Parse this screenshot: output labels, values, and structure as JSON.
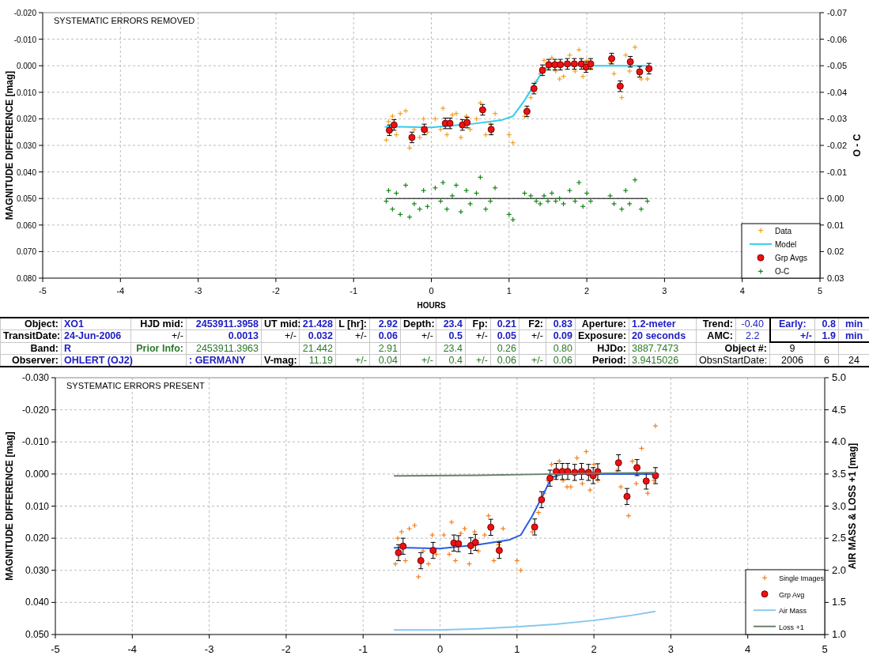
{
  "charts": [
    {
      "chart_data": {
        "type": "scatter",
        "title": "SYSTEMATIC ERRORS REMOVED",
        "xlabel": "HOURS",
        "ylabel": "MAGNITUDE DIFFERENCE [mag]",
        "y2label": "O - C",
        "grid": true,
        "legend": "lower right",
        "xlim": [
          -5,
          5
        ],
        "ylim": [
          0.08,
          -0.02
        ],
        "y2lim": [
          0.03,
          -0.07
        ],
        "ref_lines": [
          {
            "axis": "y2",
            "value": 0,
            "color": "#000000"
          }
        ],
        "xticks": [
          -5,
          -4,
          -3,
          -2,
          -1,
          0,
          1,
          2,
          3,
          4,
          5
        ],
        "yticks": [
          {
            "value": -0.02,
            "label": "-0.020"
          },
          {
            "value": -0.01,
            "label": "-0.010"
          },
          {
            "value": 0,
            "label": "0.000"
          },
          {
            "value": 0.01,
            "label": "0.010"
          },
          {
            "value": 0.02,
            "label": "0.020"
          },
          {
            "value": 0.03,
            "label": "0.030"
          },
          {
            "value": 0.04,
            "label": "0.040"
          },
          {
            "value": 0.05,
            "label": "0.050"
          },
          {
            "value": 0.06,
            "label": "0.060"
          },
          {
            "value": 0.07,
            "label": "0.070"
          },
          {
            "value": 0.08,
            "label": "0.080"
          }
        ],
        "y2ticks": [
          {
            "value": -0.07,
            "label": "-0.07"
          },
          {
            "value": -0.06,
            "label": "-0.06"
          },
          {
            "value": -0.05,
            "label": "-0.05"
          },
          {
            "value": -0.04,
            "label": "-0.04"
          },
          {
            "value": -0.03,
            "label": "-0.03"
          },
          {
            "value": -0.02,
            "label": "-0.02"
          },
          {
            "value": -0.01,
            "label": "-0.01"
          },
          {
            "value": 0,
            "label": "0.00"
          },
          {
            "value": 0.01,
            "label": "0.01"
          },
          {
            "value": 0.02,
            "label": "0.02"
          },
          {
            "value": 0.03,
            "label": "0.03"
          }
        ],
        "series": [
          {
            "name": "Data",
            "type": "scatter",
            "color": "#f0a020",
            "x": [
              -0.58,
              -0.55,
              -0.5,
              -0.45,
              -0.4,
              -0.33,
              -0.28,
              -0.22,
              -0.15,
              -0.1,
              -0.05,
              0.05,
              0.12,
              0.15,
              0.2,
              0.27,
              0.32,
              0.38,
              0.45,
              0.5,
              0.58,
              0.63,
              0.7,
              0.76,
              0.82,
              1.0,
              1.05,
              1.2,
              1.28,
              1.35,
              1.4,
              1.45,
              1.5,
              1.55,
              1.6,
              1.65,
              1.7,
              1.78,
              1.85,
              1.9,
              1.95,
              2.0,
              2.05,
              2.3,
              2.35,
              2.45,
              2.5,
              2.55,
              2.62,
              2.7,
              2.78
            ],
            "values": [
              0.028,
              0.021,
              0.019,
              0.026,
              0.018,
              0.017,
              0.031,
              0.024,
              0.027,
              0.02,
              0.025,
              0.02,
              0.024,
              0.016,
              0.026,
              0.0185,
              0.018,
              0.027,
              0.019,
              0.024,
              0.02,
              0.014,
              0.026,
              0.022,
              0.018,
              0.026,
              0.029,
              0.019,
              0.012,
              0.006,
              0.003,
              -0.002,
              0.001,
              -0.003,
              0.002,
              0.005,
              0.004,
              -0.004,
              0.002,
              -0.006,
              0.004,
              -0.002,
              0.001,
              -0.001,
              0.003,
              0.012,
              -0.004,
              0.002,
              -0.007,
              0.005,
              0.005
            ]
          },
          {
            "name": "Model",
            "type": "line",
            "color": "#33ccee",
            "x": [
              -0.6,
              -0.4,
              0,
              0.5,
              0.9,
              1.05,
              1.2,
              1.35,
              1.45,
              1.6,
              2.8
            ],
            "values": [
              0.023,
              0.023,
              0.0232,
              0.022,
              0.0205,
              0.019,
              0.013,
              0.006,
              0.001,
              0,
              0
            ]
          },
          {
            "name": "Grp Avgs",
            "type": "scatter",
            "color": "#ee1111",
            "errors": [
              0.002,
              0.002,
              0.002,
              0.002,
              0.002,
              0.002,
              0.002,
              0.002,
              0.002,
              0.002,
              0.002,
              0.002,
              0.002,
              0.002,
              0.002,
              0.002,
              0.002,
              0.002,
              0.002,
              0.002,
              0.002,
              0.002,
              0.002,
              0.002,
              0.002,
              0.002
            ],
            "x": [
              -0.54,
              -0.48,
              -0.25,
              -0.09,
              0.18,
              0.24,
              0.4,
              0.46,
              0.66,
              0.77,
              1.23,
              1.32,
              1.43,
              1.51,
              1.59,
              1.66,
              1.75,
              1.84,
              1.93,
              1.99,
              2.05,
              2.32,
              2.43,
              2.56,
              2.68,
              2.8
            ],
            "values": [
              0.0243,
              0.0223,
              0.027,
              0.024,
              0.0217,
              0.0217,
              0.0223,
              0.0214,
              0.0166,
              0.024,
              0.0172,
              0.0086,
              0.0017,
              -0.0004,
              -0.0004,
              -0.0004,
              -0.0007,
              -0.0007,
              -0.0007,
              0.0005,
              -0.0007,
              -0.0027,
              0.0077,
              -0.0015,
              0.0023,
              0.0011
            ]
          },
          {
            "name": "O-C",
            "type": "scatter",
            "axis": "y2",
            "color": "#118811",
            "x": [
              -0.58,
              -0.55,
              -0.5,
              -0.45,
              -0.4,
              -0.33,
              -0.28,
              -0.22,
              -0.15,
              -0.1,
              -0.05,
              0.05,
              0.12,
              0.15,
              0.2,
              0.27,
              0.32,
              0.38,
              0.45,
              0.5,
              0.58,
              0.63,
              0.7,
              0.76,
              0.82,
              1.0,
              1.05,
              1.2,
              1.28,
              1.35,
              1.4,
              1.45,
              1.5,
              1.55,
              1.6,
              1.65,
              1.7,
              1.78,
              1.85,
              1.9,
              1.95,
              2.0,
              2.05,
              2.3,
              2.35,
              2.45,
              2.5,
              2.55,
              2.62,
              2.7,
              2.78
            ],
            "values": [
              0.001,
              -0.003,
              0.004,
              -0.002,
              0.006,
              -0.005,
              0.007,
              0.002,
              0.004,
              -0.003,
              0.003,
              -0.004,
              0.001,
              -0.006,
              0.004,
              -0.001,
              -0.005,
              0.005,
              -0.003,
              0.002,
              -0.002,
              -0.008,
              0.004,
              0.001,
              -0.004,
              0.006,
              0.008,
              -0.002,
              -0.001,
              0.001,
              0.002,
              -0.001,
              0.001,
              -0.002,
              0.001,
              0,
              0.002,
              -0.003,
              0.001,
              -0.006,
              0.003,
              -0.002,
              0.001,
              -0.001,
              0.002,
              0.004,
              -0.003,
              0.002,
              -0.007,
              0.004,
              0.001
            ]
          }
        ]
      }
    },
    {
      "table": {
        "rows": [
          [
            {
              "text": "Object:",
              "kind": "label"
            },
            {
              "text": "XO1",
              "kind": "text"
            },
            {
              "text": "HJD mid:",
              "kind": "label"
            },
            {
              "text": "2453911.3958",
              "kind": "value"
            },
            {
              "text": "UT mid:",
              "kind": "label"
            },
            {
              "text": "21.428",
              "kind": "value"
            },
            {
              "text": "L [hr]:",
              "kind": "label"
            },
            {
              "text": "2.92",
              "kind": "value"
            },
            {
              "text": "Depth:",
              "kind": "label"
            },
            {
              "text": "23.4",
              "kind": "value"
            },
            {
              "text": "Fp:",
              "kind": "label"
            },
            {
              "text": "0.21",
              "kind": "value"
            },
            {
              "text": "F2:",
              "kind": "label"
            },
            {
              "text": "0.83",
              "kind": "value"
            },
            {
              "text": "Aperture:",
              "kind": "label"
            },
            {
              "text": "1.2-meter",
              "kind": "text"
            },
            {
              "text": "Trend:",
              "kind": "label"
            },
            {
              "text": "-0.40",
              "kind": "plain_blue"
            },
            {
              "text": "Early:",
              "kind": "value_center"
            },
            {
              "text": "0.8",
              "kind": "value"
            },
            {
              "text": "min",
              "kind": "value_center"
            }
          ],
          [
            {
              "text": "TransitDate:",
              "kind": "label"
            },
            {
              "text": "24-Jun-2006",
              "kind": "text"
            },
            {
              "text": "+/-",
              "kind": "plain"
            },
            {
              "text": "0.0013",
              "kind": "value"
            },
            {
              "text": "+/-",
              "kind": "plain"
            },
            {
              "text": "0.032",
              "kind": "value"
            },
            {
              "text": "+/-",
              "kind": "plain"
            },
            {
              "text": "0.06",
              "kind": "value"
            },
            {
              "text": "+/-",
              "kind": "plain"
            },
            {
              "text": "0.5",
              "kind": "value"
            },
            {
              "text": "+/-",
              "kind": "plain"
            },
            {
              "text": "0.05",
              "kind": "value"
            },
            {
              "text": "+/-",
              "kind": "plain"
            },
            {
              "text": "0.09",
              "kind": "value"
            },
            {
              "text": "Exposure:",
              "kind": "label"
            },
            {
              "text": "20 seconds",
              "kind": "text"
            },
            {
              "text": "AMC:",
              "kind": "label"
            },
            {
              "text": "2.2",
              "kind": "plain_blue"
            },
            {
              "text": "+/-",
              "kind": "value"
            },
            {
              "text": "1.9",
              "kind": "value"
            },
            {
              "text": "min",
              "kind": "value_center"
            }
          ],
          [
            {
              "text": "Band:",
              "kind": "label"
            },
            {
              "text": "R",
              "kind": "text"
            },
            {
              "text": "Prior Info:",
              "kind": "prior_label"
            },
            {
              "text": "2453911.3963",
              "kind": "prior"
            },
            {
              "kind": "empty"
            },
            {
              "text": "21.442",
              "kind": "prior"
            },
            {
              "kind": "empty"
            },
            {
              "text": "2.91",
              "kind": "prior"
            },
            {
              "kind": "empty"
            },
            {
              "text": "23.4",
              "kind": "prior"
            },
            {
              "kind": "empty"
            },
            {
              "text": "0.26",
              "kind": "prior"
            },
            {
              "kind": "empty"
            },
            {
              "text": "0.80",
              "kind": "prior"
            },
            {
              "text": "HJDo:",
              "kind": "label"
            },
            {
              "text": "3887.7473",
              "kind": "prior_left"
            },
            {
              "text": "Object #:",
              "kind": "label",
              "colspan": 2
            },
            {
              "text": "9",
              "kind": "plain_center"
            },
            {
              "kind": "empty"
            },
            {
              "kind": "empty"
            }
          ],
          [
            {
              "text": "Observer:",
              "kind": "label"
            },
            {
              "text": "OHLERT (OJ2)",
              "kind": "text"
            },
            {
              "kind": "empty"
            },
            {
              "text": ": GERMANY",
              "kind": "text"
            },
            {
              "text": "V-mag:",
              "kind": "label"
            },
            {
              "text": "11.19",
              "kind": "prior"
            },
            {
              "text": "+/-",
              "kind": "prior"
            },
            {
              "text": "0.04",
              "kind": "prior"
            },
            {
              "text": "+/-",
              "kind": "prior"
            },
            {
              "text": "0.4",
              "kind": "prior"
            },
            {
              "text": "+/-",
              "kind": "prior"
            },
            {
              "text": "0.06",
              "kind": "prior"
            },
            {
              "text": "+/-",
              "kind": "prior"
            },
            {
              "text": "0.06",
              "kind": "prior"
            },
            {
              "text": "Period:",
              "kind": "label"
            },
            {
              "text": "3.9415026",
              "kind": "prior_left"
            },
            {
              "text": "ObsnStartDate:",
              "kind": "plain",
              "colspan": 2
            },
            {
              "text": "2006",
              "kind": "plain_center"
            },
            {
              "text": "6",
              "kind": "plain_center"
            },
            {
              "text": "24",
              "kind": "plain_center"
            }
          ]
        ]
      }
    },
    {
      "chart_data": {
        "type": "scatter",
        "title": "SYSTEMATIC ERRORS PRESENT",
        "ylabel": "MAGNITUDE DIFFERENCE [mag]",
        "y2label": "AIR MASS & LOSS +1 [mag]",
        "grid": true,
        "legend": "lower right",
        "xlim": [
          -5,
          5
        ],
        "ylim": [
          0.05,
          -0.03
        ],
        "y2lim": [
          1,
          5
        ],
        "xticks": [
          -5,
          -4,
          -3,
          -2,
          -1,
          0,
          1,
          2,
          3,
          4,
          5
        ],
        "yticks": [
          {
            "value": -0.03,
            "label": "-0.030"
          },
          {
            "value": -0.02,
            "label": "-0.020"
          },
          {
            "value": -0.01,
            "label": "-0.010"
          },
          {
            "value": 0,
            "label": "0.000"
          },
          {
            "value": 0.01,
            "label": "0.010"
          },
          {
            "value": 0.02,
            "label": "0.020"
          },
          {
            "value": 0.03,
            "label": "0.030"
          },
          {
            "value": 0.04,
            "label": "0.040"
          },
          {
            "value": 0.05,
            "label": "0.050"
          }
        ],
        "y2ticks": [
          {
            "value": 5,
            "label": "5.0"
          },
          {
            "value": 4.5,
            "label": "4.5"
          },
          {
            "value": 4,
            "label": "4.0"
          },
          {
            "value": 3.5,
            "label": "3.5"
          },
          {
            "value": 3,
            "label": "3.0"
          },
          {
            "value": 2.5,
            "label": "2.5"
          },
          {
            "value": 2,
            "label": "2.0"
          },
          {
            "value": 1.5,
            "label": "1.5"
          },
          {
            "value": 1,
            "label": "1.0"
          }
        ],
        "series": [
          {
            "name": "Single Images",
            "type": "scatter",
            "color": "#f08020",
            "x": [
              -0.58,
              -0.55,
              -0.5,
              -0.45,
              -0.4,
              -0.33,
              -0.28,
              -0.22,
              -0.15,
              -0.1,
              -0.05,
              0.05,
              0.12,
              0.15,
              0.2,
              0.27,
              0.32,
              0.38,
              0.45,
              0.5,
              0.58,
              0.63,
              0.7,
              0.76,
              0.82,
              1.0,
              1.05,
              1.2,
              1.28,
              1.35,
              1.4,
              1.45,
              1.5,
              1.55,
              1.6,
              1.65,
              1.7,
              1.78,
              1.85,
              1.9,
              1.95,
              2.0,
              2.05,
              2.3,
              2.35,
              2.45,
              2.5,
              2.55,
              2.62,
              2.7,
              2.78,
              2.8
            ],
            "values": [
              0.028,
              0.02,
              0.018,
              0.027,
              0.017,
              0.016,
              0.032,
              0.024,
              0.028,
              0.019,
              0.025,
              0.019,
              0.025,
              0.015,
              0.027,
              0.0185,
              0.017,
              0.028,
              0.018,
              0.024,
              0.019,
              0.013,
              0.027,
              0.022,
              0.017,
              0.027,
              0.03,
              0.018,
              0.012,
              0.006,
              0.002,
              -0.003,
              0.001,
              -0.004,
              0.002,
              0.004,
              0.004,
              -0.005,
              0.003,
              -0.007,
              0.005,
              -0.003,
              0.002,
              -0.001,
              0.004,
              0.013,
              -0.004,
              0.003,
              -0.008,
              0.006,
              0.002,
              -0.015
            ]
          },
          {
            "type": "line",
            "color": "#2a5ee0",
            "x": [
              -0.6,
              -0.4,
              0,
              0.5,
              0.9,
              1.05,
              1.2,
              1.35,
              1.45,
              1.6,
              2.8
            ],
            "values": [
              0.023,
              0.023,
              0.0232,
              0.022,
              0.0205,
              0.019,
              0.013,
              0.006,
              0.001,
              0,
              0
            ]
          },
          {
            "name": "Grp Avg",
            "type": "scatter",
            "color": "#ee1111",
            "errors": [
              0.0025,
              0.0025,
              0.0025,
              0.0025,
              0.0025,
              0.0025,
              0.0025,
              0.0025,
              0.0025,
              0.0025,
              0.0025,
              0.0025,
              0.0025,
              0.0025,
              0.0025,
              0.0025,
              0.0025,
              0.0025,
              0.0025,
              0.0025,
              0.0025,
              0.0025,
              0.0025,
              0.0025,
              0.0025,
              0.0025
            ],
            "x": [
              -0.54,
              -0.48,
              -0.25,
              -0.09,
              0.18,
              0.24,
              0.4,
              0.46,
              0.66,
              0.77,
              1.23,
              1.32,
              1.43,
              1.51,
              1.59,
              1.66,
              1.75,
              1.84,
              1.93,
              1.99,
              2.05,
              2.32,
              2.43,
              2.56,
              2.68,
              2.8
            ],
            "values": [
              0.0245,
              0.0225,
              0.027,
              0.0238,
              0.0215,
              0.0217,
              0.0223,
              0.0213,
              0.0166,
              0.0238,
              0.0165,
              0.008,
              0.0013,
              -0.0008,
              -0.0008,
              -0.0008,
              -0.0005,
              -0.0008,
              -0.0005,
              0.0005,
              -0.0007,
              -0.0035,
              0.007,
              -0.002,
              0.0022,
              0.0005
            ]
          },
          {
            "name": "Air Mass",
            "type": "line",
            "axis": "y2",
            "color": "#88c8ee",
            "x": [
              -0.6,
              0,
              0.5,
              1,
              1.5,
              2,
              2.5,
              2.8
            ],
            "values": [
              1.07,
              1.07,
              1.09,
              1.12,
              1.16,
              1.22,
              1.3,
              1.36
            ]
          },
          {
            "name": "Loss +1",
            "type": "line",
            "axis": "y2",
            "color": "#6b806b",
            "x": [
              -0.6,
              0.5,
              1.5,
              2.8
            ],
            "values": [
              3.47,
              3.48,
              3.5,
              3.52
            ]
          }
        ]
      }
    }
  ]
}
